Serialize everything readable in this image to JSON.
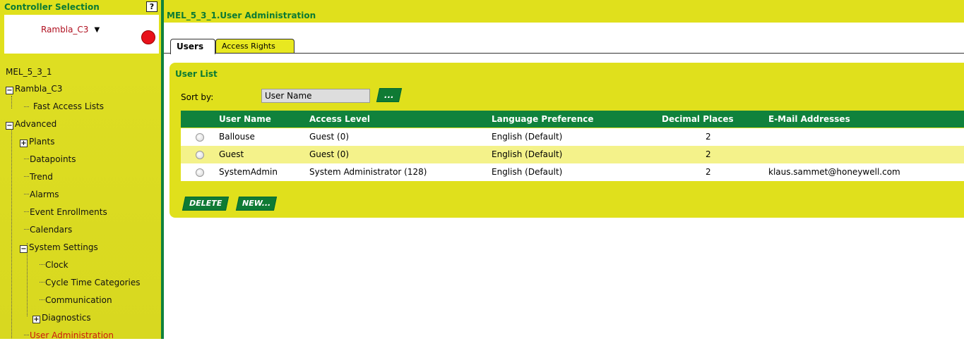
{
  "left_panel": {
    "title": "Controller Selection",
    "help_label": "?",
    "controller": "Rambla_C3",
    "status_color": "#e8121a"
  },
  "tree": {
    "root": "MEL_5_3_1",
    "nodes": {
      "rambla": "Rambla_C3",
      "fast_access": "Fast Access Lists",
      "advanced": "Advanced",
      "plants": "Plants",
      "datapoints": "Datapoints",
      "trend": "Trend",
      "alarms": "Alarms",
      "event_enrollments": "Event Enrollments",
      "calendars": "Calendars",
      "system_settings": "System Settings",
      "clock": "Clock",
      "cycle_time": "Cycle Time Categories",
      "communication": "Communication",
      "diagnostics": "Diagnostics",
      "user_admin": "User Administration"
    }
  },
  "main": {
    "title": "MEL_5_3_1.User Administration",
    "tabs": [
      "Users",
      "Access Rights"
    ],
    "panel_title": "User List",
    "sort_label": "Sort by:",
    "sort_value": "User Name",
    "sort_button": "...",
    "columns": [
      "User Name",
      "Access Level",
      "Language Preference",
      "Decimal Places",
      "E-Mail Addresses"
    ],
    "rows": [
      {
        "user": "Ballouse",
        "level": "Guest (0)",
        "lang": "English (Default)",
        "decimals": "2",
        "email": ""
      },
      {
        "user": "Guest",
        "level": "Guest (0)",
        "lang": "English (Default)",
        "decimals": "2",
        "email": ""
      },
      {
        "user": "SystemAdmin",
        "level": "System Administrator (128)",
        "lang": "English (Default)",
        "decimals": "2",
        "email": "klaus.sammet@honeywell.com"
      }
    ],
    "delete_button": "DELETE",
    "new_button": "NEW..."
  },
  "colors": {
    "accent_yellow": "#e0e01c",
    "accent_green": "#10823c",
    "active_red": "#cc1a10"
  }
}
